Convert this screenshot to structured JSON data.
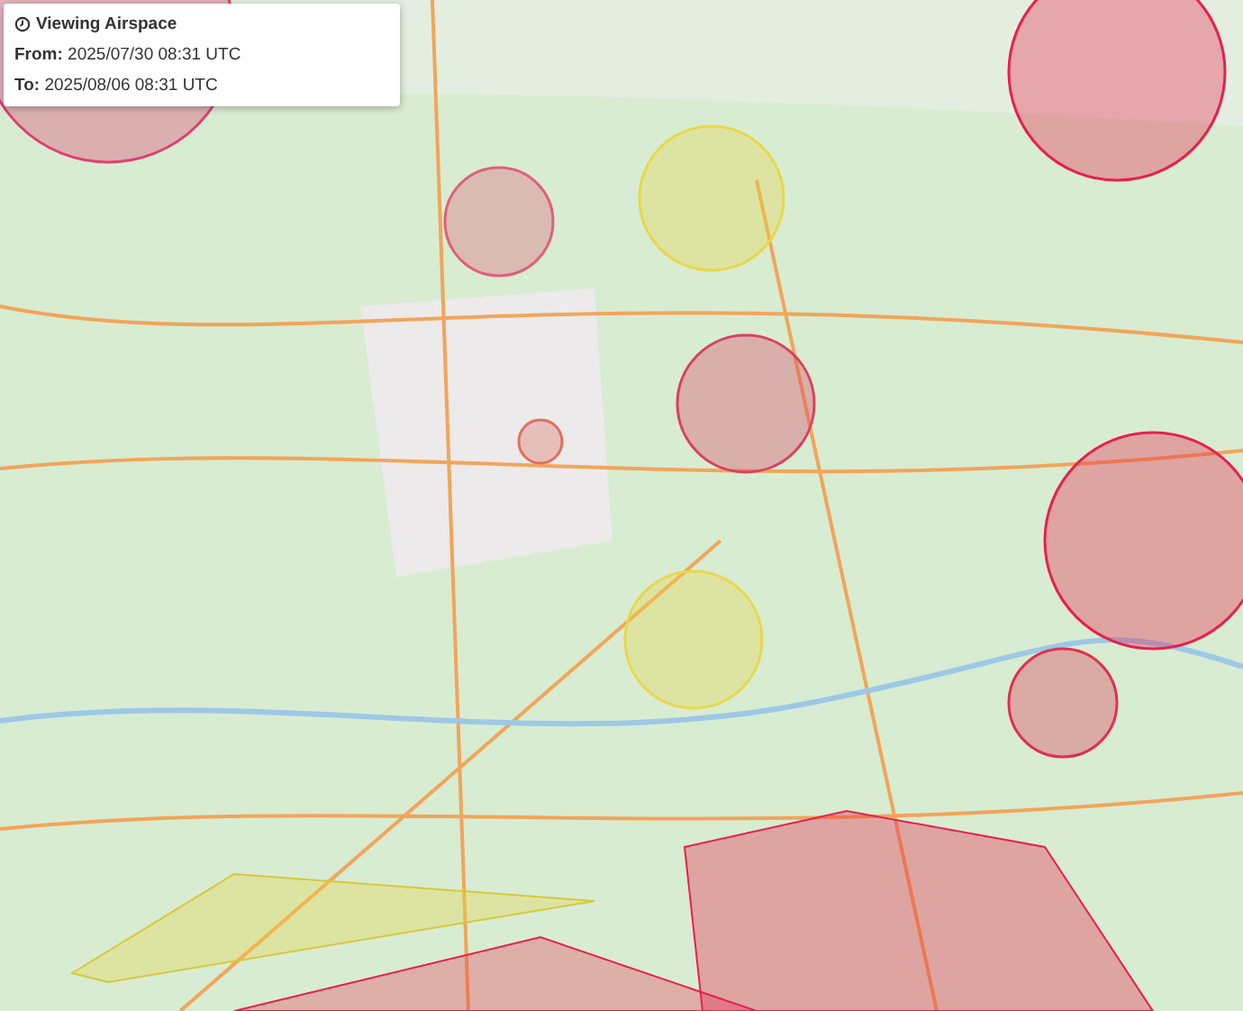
{
  "info_panel": {
    "title": "Viewing Airspace",
    "lines": [
      "**From:** 2025/07/30 08:31 UTC",
      "**To:** 2025/08/06 08:31 UTC"
    ]
  }
}
